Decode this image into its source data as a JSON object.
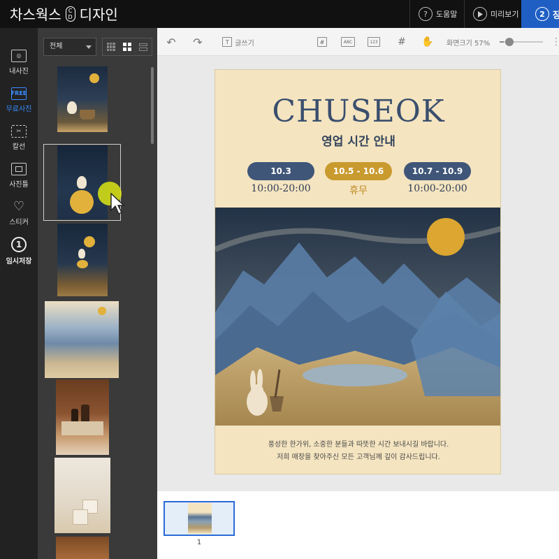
{
  "app": {
    "logo_left": "차스웍스",
    "logo_mark_top": "C",
    "logo_mark_bottom": "D",
    "logo_right": "디자인",
    "help_label": "도움말",
    "help_icon_glyph": "?",
    "preview_label": "미리보기",
    "step_number": "2",
    "step_label": "장"
  },
  "sidebar": {
    "items": [
      {
        "label": "내사진",
        "icon": "camera-icon",
        "icon_glyph": "◎"
      },
      {
        "label": "무료사진",
        "icon": "free-photo-icon",
        "icon_glyph": "FREE",
        "active": true
      },
      {
        "label": "칼선",
        "icon": "scissors-icon",
        "icon_glyph": "✂"
      },
      {
        "label": "사진틀",
        "icon": "frame-icon",
        "icon_glyph": ""
      },
      {
        "label": "스티커",
        "icon": "heart-icon",
        "icon_glyph": "♡"
      },
      {
        "label": "임시저장",
        "icon": "save-number-icon",
        "icon_glyph": "1"
      }
    ]
  },
  "gallery": {
    "filter_value": "전체"
  },
  "toolbar": {
    "text_label": "글쓰기",
    "text_icon_glyph": "T",
    "hash_icon_glyph": "#",
    "abc_label": "ABC",
    "num_label": "123",
    "zoom_label": "화면크기 57%",
    "zoom_level": 0.57
  },
  "poster": {
    "title": "CHUSEOK",
    "subtitle": "영업 시간 안내",
    "dates": [
      {
        "date": "10.3",
        "hours": "10:00-20:00",
        "color": "#3f5678"
      },
      {
        "date": "10.5 - 10.6",
        "hours": "휴무",
        "color": "#c99a2e"
      },
      {
        "date": "10.7 - 10.9",
        "hours": "10:00-20:00",
        "color": "#3f5678"
      }
    ],
    "footer_line1": "풍성한 한가위, 소중한 분들과 따뜻한 시간 보내시길 바랍니다.",
    "footer_line2": "저희 매장을 찾아주신 모든 고객님께 깊이 감사드립니다."
  },
  "pages": {
    "current": "1"
  },
  "colors": {
    "topbar": "#111111",
    "accent_blue": "#1f5fc4",
    "poster_bg": "#f4e4c0",
    "poster_navy": "#3a4e6d",
    "poster_gold": "#c99a2e"
  }
}
